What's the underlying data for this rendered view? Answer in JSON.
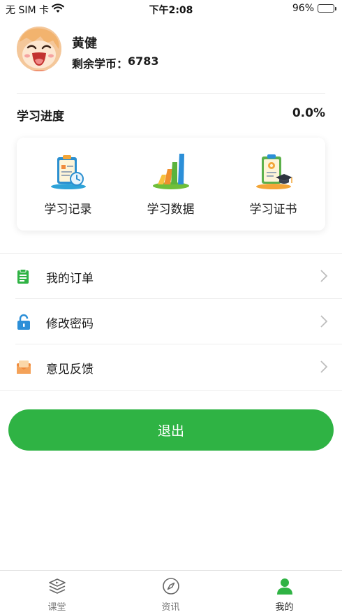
{
  "status_bar": {
    "carrier": "无 SIM 卡",
    "time": "下午2:08",
    "battery_percent": "96%",
    "battery_level": 0.96,
    "wifi_icon": "wifi-icon"
  },
  "profile": {
    "name": "黄健",
    "coin_label": "剩余学币：",
    "coin_value": "6783"
  },
  "progress": {
    "label": "学习进度",
    "value": "0.0%"
  },
  "card_items": [
    {
      "label": "学习记录",
      "icon": "clipboard-clock-icon"
    },
    {
      "label": "学习数据",
      "icon": "bar-chart-icon"
    },
    {
      "label": "学习证书",
      "icon": "certificate-icon"
    }
  ],
  "menu": [
    {
      "label": "我的订单",
      "icon": "order-list-icon"
    },
    {
      "label": "修改密码",
      "icon": "lock-icon"
    },
    {
      "label": "意见反馈",
      "icon": "feedback-mail-icon"
    }
  ],
  "logout_label": "退出",
  "tabs": [
    {
      "label": "课堂",
      "icon": "classroom-icon"
    },
    {
      "label": "资讯",
      "icon": "compass-icon"
    },
    {
      "label": "我的",
      "icon": "person-icon"
    }
  ],
  "colors": {
    "accent": "#2fb344",
    "battery": "#34c759"
  }
}
